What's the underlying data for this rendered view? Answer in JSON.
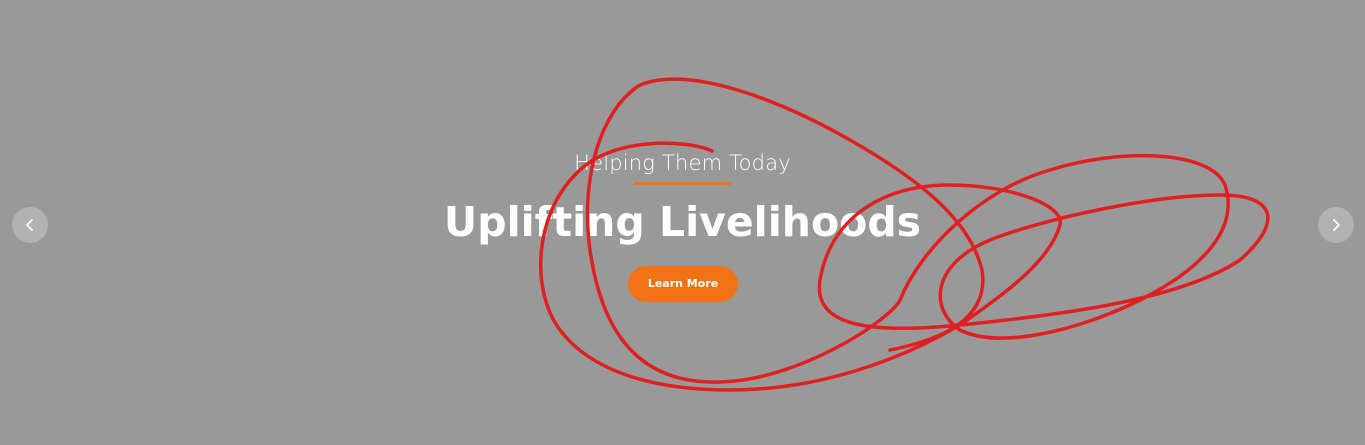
{
  "slider": {
    "subtitle": "Helping Them Today",
    "title": "Uplifting Livelihoods",
    "cta_label": "Learn More",
    "prev_icon": "chevron-left-icon",
    "next_icon": "chevron-right-icon"
  },
  "colors": {
    "background": "#999999",
    "accent": "#f47216",
    "text": "#ffffff",
    "annotation": "#e02020"
  }
}
